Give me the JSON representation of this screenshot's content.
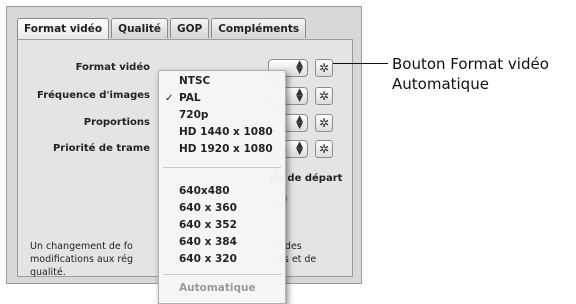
{
  "tabs": [
    {
      "label": "Format vidéo"
    },
    {
      "label": "Qualité"
    },
    {
      "label": "GOP"
    },
    {
      "label": "Compléments"
    }
  ],
  "settings": [
    {
      "label": "Format vidéo"
    },
    {
      "label": "Fréquence d'images"
    },
    {
      "label": "Proportions"
    },
    {
      "label": "Priorité de trame"
    }
  ],
  "timecode_fragment": "de de départ",
  "note": "Un changement de fo ... r des modifications aux rég ... es et de qualité.",
  "note_lines": [
    "Un changement de fo",
    "r des",
    "modifications aux rég",
    "es et de",
    "qualité."
  ],
  "menu": {
    "items": [
      "NTSC",
      "PAL",
      "720p",
      "HD 1440 x 1080",
      "HD 1920 x 1080",
      "640x480",
      "640 x 360",
      "640 x 352",
      "640 x 384",
      "640 x 320"
    ],
    "checked_item": "PAL",
    "disabled_item": "Automatique"
  },
  "callout": {
    "line1": "Bouton Format vidéo",
    "line2": "Automatique"
  }
}
